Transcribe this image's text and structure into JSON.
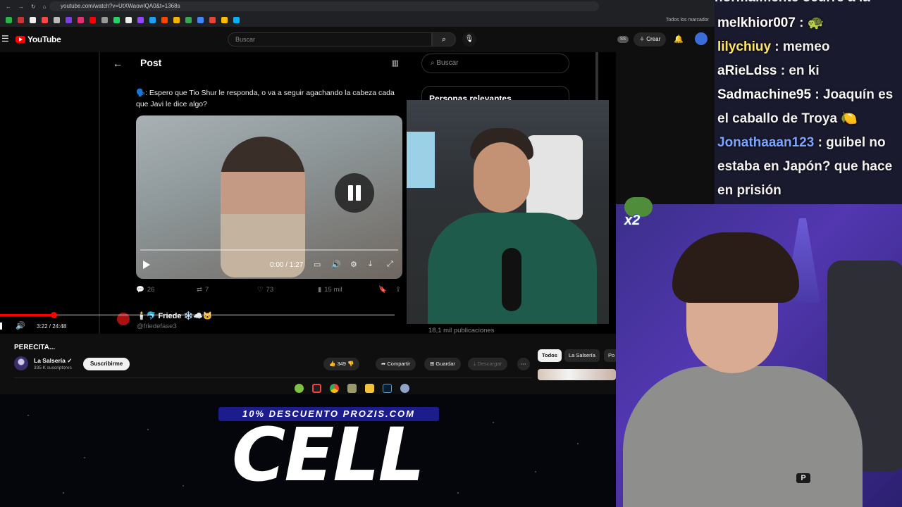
{
  "browser": {
    "url": "youtube.com/watch?v=UtXWaowIQA0&t=1368s",
    "bookmarks_label": "Todos los marcador"
  },
  "youtube": {
    "logo_text": "YouTube",
    "search_placeholder": "Buscar",
    "header_badge": "SS",
    "create_label": "Crear"
  },
  "tweet": {
    "heading": "Post",
    "text": "🗣️: Espero que Tio Shur le responda, o va a seguir agachando la cabeza cada que Javi le dice algo?",
    "video_time": "0:00 / 1:27",
    "replies": "26",
    "reposts": "7",
    "likes": "73",
    "views": "15 mil",
    "next_author_name": "🕯️🐬 Friede ❄️☁️🐱",
    "next_author_handle": "@friedefase3"
  },
  "x_sidebar": {
    "search_placeholder": "Buscar",
    "relevant_heading": "Personas relevantes",
    "posts_count": "18,1 mil publicaciones"
  },
  "player": {
    "time": "3:22 / 24:48",
    "progress_fraction": 0.136
  },
  "video": {
    "title": "PERECITA...",
    "channel_name": "La Salsería ✓",
    "channel_subs": "335 K suscriptores",
    "subscribe_label": "Suscribirme",
    "likes": "349",
    "share_label": "Compartir",
    "save_label": "Guardar",
    "download_label": "Descargar",
    "more_label": "⋯"
  },
  "chips": [
    "Todos",
    "La Salsería",
    "Po"
  ],
  "chat": {
    "top_clip": "normalmente ocurre a la",
    "messages": [
      {
        "user": "melkhior007",
        "color": "#ffffff",
        "text": " : 🐢"
      },
      {
        "user": "lilychiuy",
        "color": "#ffe66b",
        "text": " : memeo"
      },
      {
        "user": "aRieLdss",
        "color": "#ffffff",
        "text": " : en ki"
      },
      {
        "user": "Sadmachine95",
        "color": "#ffffff",
        "text": " : Joaquín es el caballo de Troya 🍋"
      },
      {
        "user": "Jonathaaan123",
        "color": "#7da4ff",
        "text": " : guibel no estaba en Japón? que hace en prisión"
      }
    ]
  },
  "emote": {
    "multiplier": "x2"
  },
  "promo": {
    "banner": "10% DESCUENTO PROZIS.COM",
    "brand": "CELL"
  },
  "streamer_shirt_logo": "P"
}
